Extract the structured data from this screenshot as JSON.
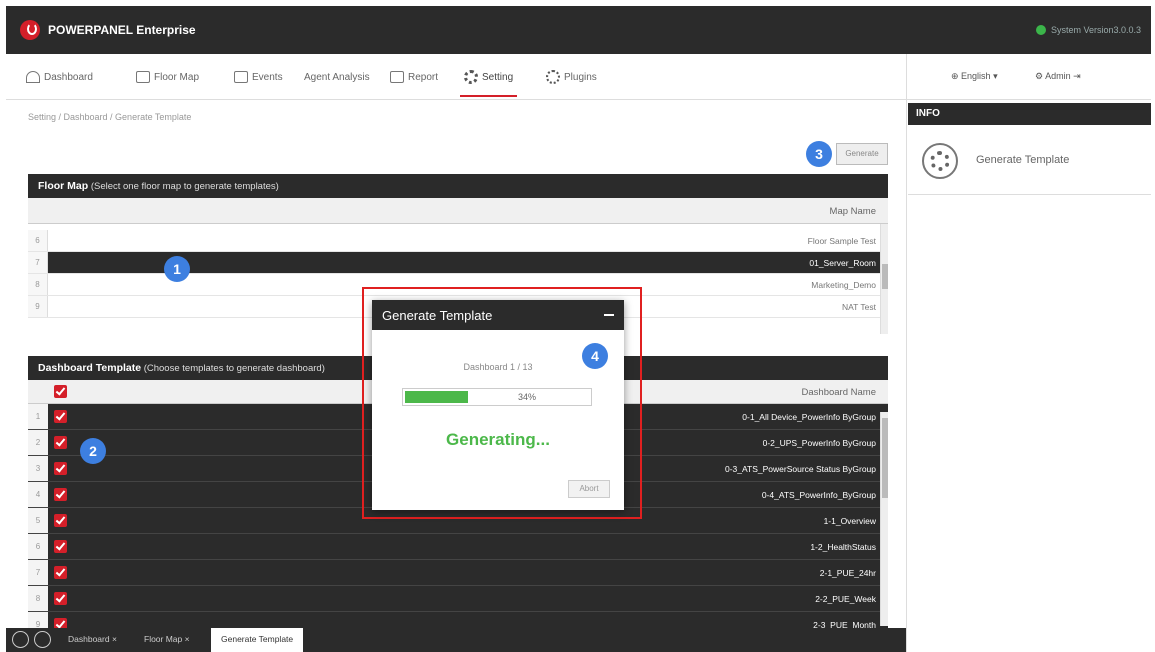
{
  "app": {
    "title": "POWERPANEL Enterprise",
    "version": "System Version3.0.0.3"
  },
  "nav": {
    "items": [
      {
        "label": "Dashboard"
      },
      {
        "label": "Floor Map"
      },
      {
        "label": "Events"
      },
      {
        "label": "Agent Analysis"
      },
      {
        "label": "Report"
      },
      {
        "label": "Setting"
      },
      {
        "label": "Plugins"
      }
    ],
    "language": "English",
    "user": "Admin"
  },
  "breadcrumb": "Setting / Dashboard / Generate Template",
  "generate_button": "Generate",
  "info": {
    "title": "INFO",
    "label": "Generate Template"
  },
  "floor_map": {
    "title": "Floor Map",
    "subtitle": "(Select one floor map to generate templates)",
    "column": "Map Name",
    "rows": [
      {
        "num": "6",
        "name": "Floor Sample Test"
      },
      {
        "num": "7",
        "name": "01_Server_Room"
      },
      {
        "num": "8",
        "name": "Marketing_Demo"
      },
      {
        "num": "9",
        "name": "NAT Test"
      }
    ],
    "selected_index": 1
  },
  "dashboard_templates": {
    "title": "Dashboard Template",
    "subtitle": "(Choose templates to generate dashboard)",
    "column": "Dashboard Name",
    "rows": [
      {
        "num": "1",
        "name": "0-1_All Device_PowerInfo ByGroup"
      },
      {
        "num": "2",
        "name": "0-2_UPS_PowerInfo ByGroup"
      },
      {
        "num": "3",
        "name": "0-3_ATS_PowerSource Status ByGroup"
      },
      {
        "num": "4",
        "name": "0-4_ATS_PowerInfo_ByGroup"
      },
      {
        "num": "5",
        "name": "1-1_Overview"
      },
      {
        "num": "6",
        "name": "1-2_HealthStatus"
      },
      {
        "num": "7",
        "name": "2-1_PUE_24hr"
      },
      {
        "num": "8",
        "name": "2-2_PUE_Week"
      },
      {
        "num": "9",
        "name": "2-3_PUE_Month"
      }
    ]
  },
  "bottom_tabs": [
    {
      "label": "Dashboard ×"
    },
    {
      "label": "Floor Map ×"
    },
    {
      "label": "Generate Template"
    }
  ],
  "modal": {
    "title": "Generate Template",
    "subtitle": "Dashboard 1 / 13",
    "progress_percent": 34,
    "progress_label": "34%",
    "status": "Generating...",
    "abort": "Abort"
  },
  "badges": [
    "1",
    "2",
    "3",
    "4"
  ],
  "colors": {
    "brand": "#d41f29",
    "dark": "#2b2b2b",
    "progress": "#4cb84a",
    "badge": "#3d7fe0",
    "highlight": "#e02020"
  }
}
